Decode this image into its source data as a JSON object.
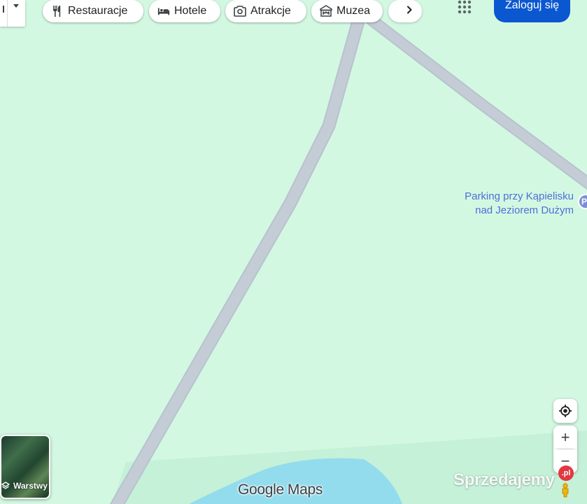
{
  "map": {
    "background_color": "#d3f8e2",
    "road_color": "#c4ccd6",
    "water_color": "#93dced"
  },
  "search": {
    "dropdown_icon": "chevron-down-icon"
  },
  "categories": [
    {
      "label": "Restauracje",
      "icon": "restaurant-icon"
    },
    {
      "label": "Hotele",
      "icon": "hotel-icon"
    },
    {
      "label": "Atrakcje",
      "icon": "camera-icon"
    },
    {
      "label": "Muzea",
      "icon": "museum-icon"
    }
  ],
  "categories_next_icon": "chevron-right-icon",
  "header": {
    "apps_icon": "apps-grid-icon",
    "signin_label": "Zaloguj się",
    "signin_color": "#0b57d0"
  },
  "place": {
    "line1": "Parking przy Kąpielisku",
    "line2": "nad Jeziorem Dużym",
    "label_color": "#4f6fd8",
    "pin_letter": "P"
  },
  "layers": {
    "label": "Warstwy",
    "icon": "layers-icon"
  },
  "controls": {
    "location_icon": "my-location-icon",
    "zoom_in_label": "+",
    "zoom_out_label": "−",
    "pegman_icon": "pegman-icon"
  },
  "branding": {
    "logo_part1": "Google",
    "logo_part2": "Maps"
  },
  "watermark": {
    "text": "Sprzedajemy",
    "badge": ".pl"
  }
}
